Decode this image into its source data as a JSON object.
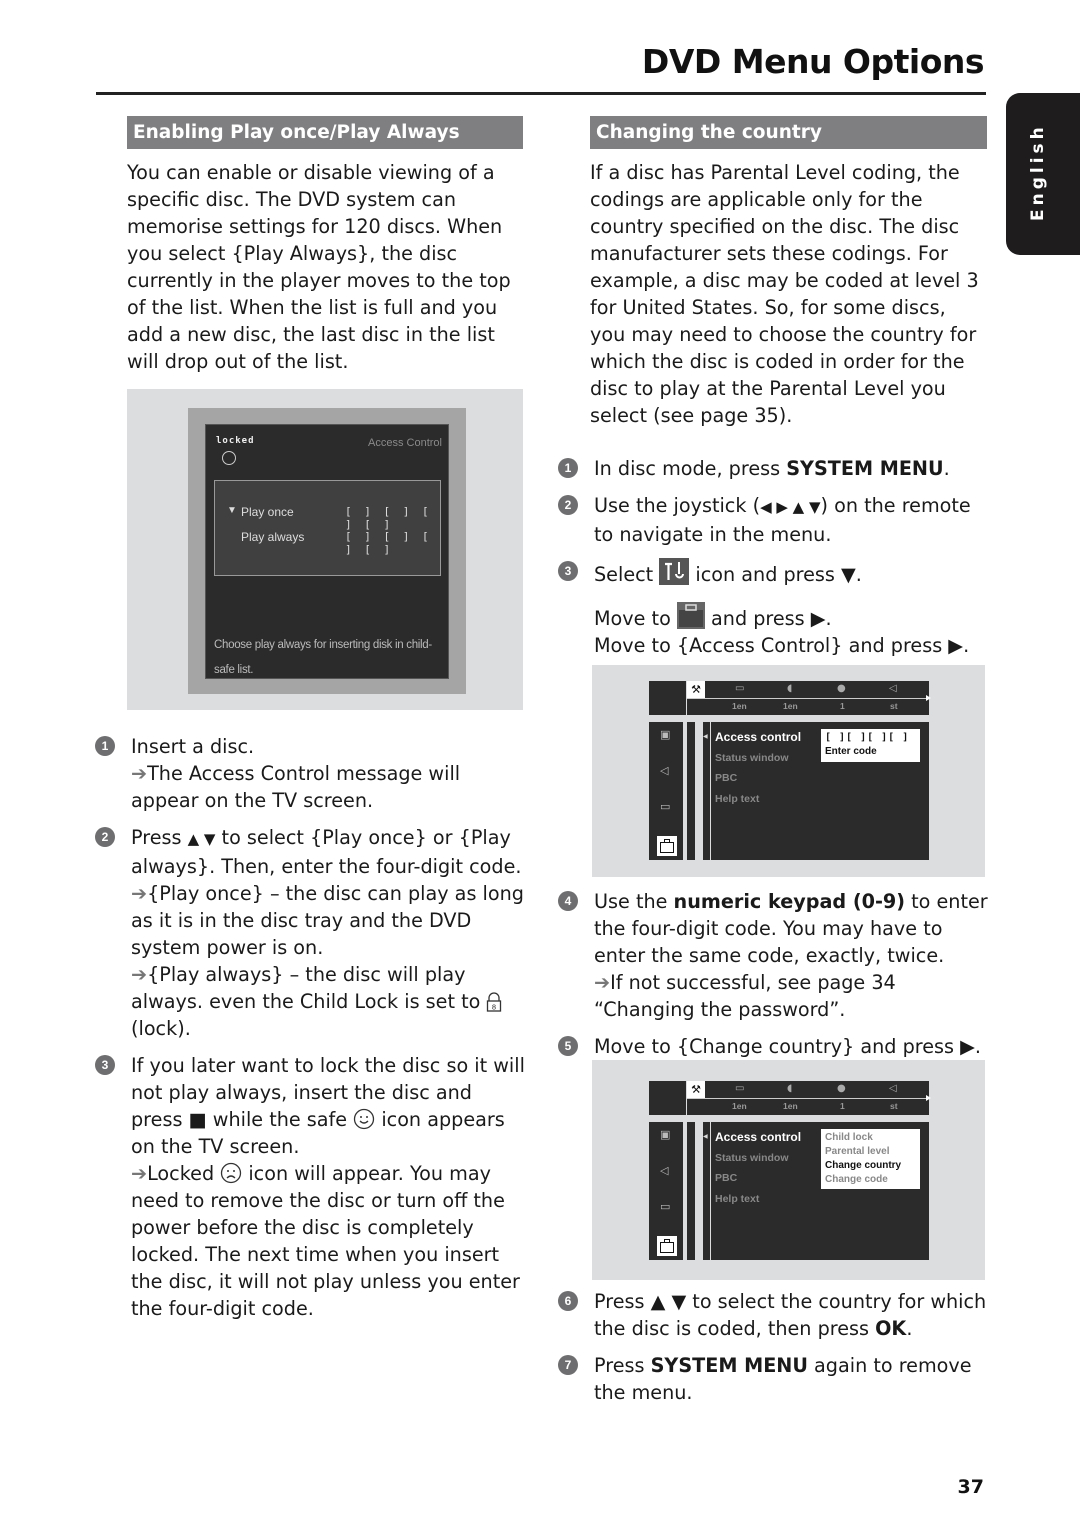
{
  "header": {
    "title": "DVD Menu Options",
    "language_tab": "English"
  },
  "left": {
    "section_title": "Enabling Play once/Play Always",
    "intro": "You can enable or disable viewing of a specific disc. The DVD system can memorise settings for 120 discs. When you select {Play Always}, the disc currently in the player moves to the top of the list. When the list is full and you add a new disc, the last disc in the list will drop out of the list.",
    "screen": {
      "status_label": "locked",
      "title": "Access Control",
      "rows": [
        {
          "label": "Play once",
          "code": "[ ] [ ] [ ] [ ]",
          "selected": true
        },
        {
          "label": "Play always",
          "code": "[ ] [ ] [ ] [ ]",
          "selected": false
        }
      ],
      "help": "Choose play always for inserting disk in child-safe list."
    },
    "steps": [
      {
        "num": "1",
        "text": "Insert a disc.",
        "result": "The Access Control message will appear on the TV screen."
      },
      {
        "num": "2",
        "text_a": "Press ",
        "keys": "▲ ▼",
        "text_b": "  to select {Play once} or {Play always}. Then, enter the four-digit code.",
        "result1": "{Play once} – the disc can play as long as it is in the disc tray and the DVD system power is on.",
        "result2_a": "{Play always} – the disc will play always. even the Child Lock is set to ",
        "result2_b": " (lock)."
      },
      {
        "num": "3",
        "text_a": "If you later want to lock the disc so it will not play always, insert the disc and press ",
        "stop": "■",
        "text_b": "  while the safe ",
        "text_c": " icon appears on the TV screen.",
        "result_a": "Locked ",
        "result_b": " icon will appear. You may need to remove the disc or turn off the power before the disc is completely locked. The next time when you insert the disc, it will not play unless you enter the four-digit code."
      }
    ]
  },
  "right": {
    "section_title": "Changing the country",
    "intro": "If a disc has Parental Level coding, the codings are applicable only for the country specified on the disc. The disc manufacturer sets these codings. For example, a disc may be coded at level 3 for United States. So, for some discs, you may need to choose the country for which the disc is coded in order for the disc to play at the Parental Level you select (see page 35).",
    "steps": [
      {
        "num": "1",
        "text_a": "In disc mode, press ",
        "bold": "SYSTEM MENU",
        "text_b": "."
      },
      {
        "num": "2",
        "text_a": "Use the joystick (",
        "keys": "◀ ▶ ▲ ▼",
        "text_b": ") on the remote to navigate in the menu."
      },
      {
        "num": "3",
        "text_a": "Select ",
        "text_b": " icon and press ▼.",
        "line2_a": "Move to ",
        "line2_b": " and press ▶.",
        "line3": "Move to {Access Control} and press ▶."
      },
      {
        "num": "4",
        "text_a": "Use the ",
        "bold": "numeric keypad (0-9)",
        "text_b": " to enter the four-digit code. You may have to enter the same code, exactly, twice.",
        "result": "If not successful, see page 34 “Changing the password”."
      },
      {
        "num": "5",
        "text": "Move to {Change country} and press ▶."
      },
      {
        "num": "6",
        "text_a": "Press ▲ ▼ to select the country for which the disc is coded, then press ",
        "bold": "OK",
        "text_b": "."
      },
      {
        "num": "7",
        "text_a": "Press ",
        "bold": "SYSTEM MENU",
        "text_b": " again to remove the menu."
      }
    ],
    "menu": {
      "top_values": [
        "1en",
        "1en",
        "1",
        "st"
      ],
      "items": [
        "Access control",
        "Status window",
        "PBC",
        "Help text"
      ],
      "popup1": {
        "code": "[  ][  ][  ][  ]",
        "label": "Enter code"
      },
      "popup2": {
        "options": [
          "Child lock",
          "Parental level",
          "Change country",
          "Change code"
        ],
        "selected": "Change country"
      }
    }
  },
  "page_number": "37"
}
